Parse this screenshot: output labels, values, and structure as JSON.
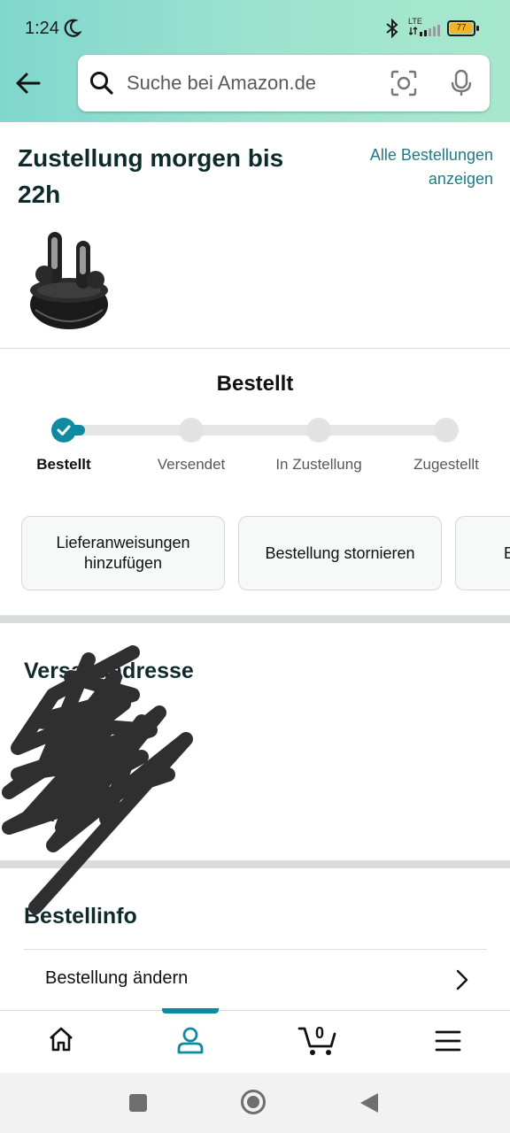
{
  "status_bar": {
    "time": "1:24",
    "network": "LTE",
    "battery": "77"
  },
  "search": {
    "placeholder": "Suche bei Amazon.de"
  },
  "order": {
    "delivery_title": "Zustellung morgen bis 22h",
    "all_orders_link": "Alle Bestellungen anzeigen",
    "status_title": "Bestellt",
    "steps": [
      "Bestellt",
      "Versendet",
      "In Zustellung",
      "Zugestellt"
    ],
    "current_step": 0,
    "actions": [
      "Lieferanweisungen hinzufügen",
      "Bestellung stornieren",
      "B"
    ]
  },
  "shipping": {
    "title": "Versandadresse",
    "lines": [
      "o",
      "rba 2"
    ]
  },
  "order_info": {
    "title": "Bestellinfo",
    "rows": [
      "Bestellung ändern"
    ]
  },
  "bottom_nav": {
    "items": [
      "home",
      "account",
      "cart",
      "menu"
    ],
    "active": "account",
    "cart_count": "0"
  },
  "colors": {
    "accent": "#0f8ba1",
    "link": "#227a87",
    "header_gradient_start": "#80d7ce",
    "header_gradient_end": "#a7e8cd",
    "battery": "#f0b429"
  }
}
